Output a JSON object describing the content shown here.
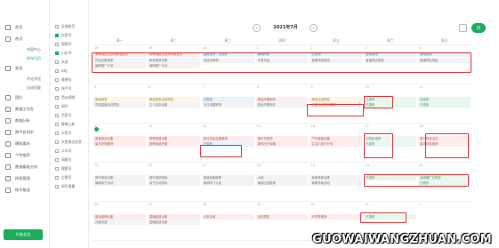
{
  "sidebar": {
    "items": [
      {
        "label": "首页",
        "icon": "home-icon"
      },
      {
        "label": "热点",
        "icon": "flame-icon"
      },
      {
        "label": "内容中心",
        "icon": "doc-icon",
        "sub": true
      },
      {
        "label": "发布日历",
        "icon": "calendar-icon",
        "sub": true,
        "active": true
      },
      {
        "label": "私信",
        "icon": "chat-icon"
      },
      {
        "label": "评论对话",
        "icon": "comment-icon",
        "sub": true
      },
      {
        "label": "自动回复",
        "icon": "reply-icon",
        "sub": true
      },
      {
        "label": "团队",
        "icon": "team-icon"
      },
      {
        "label": "数据工作台",
        "icon": "chart-icon"
      },
      {
        "label": "数据分析",
        "icon": "analytics-icon"
      },
      {
        "label": "跨平台同步",
        "icon": "sync-icon"
      },
      {
        "label": "爆款素材",
        "icon": "star-icon"
      },
      {
        "label": "个性推荐",
        "icon": "bulb-icon"
      },
      {
        "label": "数据看板分析",
        "icon": "board-icon"
      },
      {
        "label": "授权管理",
        "icon": "key-icon"
      },
      {
        "label": "帐号推送",
        "icon": "user-icon"
      }
    ],
    "footer_label": "升级会员"
  },
  "accounts": [
    {
      "label": "全部帐号",
      "checked": false
    },
    {
      "label": "抖音号",
      "checked": true
    },
    {
      "label": "视频号",
      "checked": false
    },
    {
      "label": "小红书",
      "checked": true
    },
    {
      "label": "头条",
      "checked": false
    },
    {
      "label": "B站",
      "checked": false
    },
    {
      "label": "微博号",
      "checked": false
    },
    {
      "label": "快手号",
      "checked": false
    },
    {
      "label": "西瓜视频",
      "checked": false
    },
    {
      "label": "知乎",
      "checked": false
    },
    {
      "label": "百家号",
      "checked": false
    },
    {
      "label": "微博上新",
      "checked": false
    },
    {
      "label": "大鱼号",
      "checked": false
    },
    {
      "label": "大鱼周边信息",
      "checked": false
    },
    {
      "label": "公众号",
      "checked": false
    },
    {
      "label": "网易号",
      "checked": false
    },
    {
      "label": "搜狐号",
      "checked": false
    },
    {
      "label": "企鹅号",
      "checked": false
    },
    {
      "label": "知乎直播",
      "checked": false
    }
  ],
  "toolbar": {
    "month_title": "2021年7月",
    "prev": "‹",
    "next": "›",
    "view_button": "月"
  },
  "weekdays": [
    "周一",
    "周二",
    "周三",
    "周四",
    "周五",
    "周六",
    "周日"
  ],
  "weeks": [
    {
      "days": [
        "28",
        "29",
        "30",
        "1",
        "2",
        "3",
        "4"
      ],
      "events": [
        [
          [
            "黑神话悟空游戏体验发布",
            "pink"
          ],
          [
            "黑神话悟空游戏体验发布",
            "pink"
          ],
          [
            "提前发布，已同步",
            "blue"
          ],
          [
            "顺利同步",
            "blue"
          ],
          [
            "已发布",
            "blue"
          ],
          [
            "自动发布",
            "blue"
          ],
          [
            "自动发布",
            "blue"
          ]
        ],
        [
          [
            "内容合集更新",
            "gray"
          ],
          [
            "新品推荐合集",
            "gray"
          ],
          [
            "内容待审核",
            "gray"
          ],
          [
            "本周总结",
            "gray"
          ],
          [
            "直播预告推送",
            "gray"
          ],
          [
            "直播预告推送",
            "gray"
          ],
          [
            "直播预告推送",
            "gray"
          ]
        ],
        [
          [
            "暑期推广计划",
            "gray"
          ],
          [
            "暑期推广计划",
            "gray"
          ],
          [
            "",
            "empty"
          ],
          [
            "",
            "empty"
          ],
          [
            "",
            "empty"
          ],
          [
            "",
            "empty"
          ],
          [
            "",
            "empty"
          ]
        ]
      ]
    },
    {
      "days": [
        "5",
        "6",
        "7",
        "8",
        "9",
        "10",
        "11"
      ],
      "events": [
        [
          [
            "",
            "empty"
          ],
          [
            "",
            "empty"
          ],
          [
            "",
            "empty"
          ],
          [
            "",
            "empty"
          ],
          [
            "",
            "empty"
          ],
          [
            "",
            "empty"
          ],
          [
            "",
            "empty"
          ]
        ],
        [
          [
            "新品首发",
            "yellow"
          ],
          [
            "新品首发活动预告",
            "yellow"
          ],
          [
            "已发布",
            "blue"
          ],
          [
            "新品开箱测评",
            "pink"
          ],
          [
            "周末活动预告",
            "yellow"
          ],
          [
            "已发布",
            "green"
          ],
          [
            "已发布",
            "green"
          ]
        ],
        [
          [
            "同城直播活动预告",
            "gray"
          ],
          [
            "达人探店合集",
            "gray"
          ],
          [
            "今日话题推荐",
            "gray"
          ],
          [
            "新品开箱测评",
            "gray"
          ],
          [
            "已发布已同步推荐",
            "pink"
          ],
          [
            "已发布",
            "green"
          ],
          [
            "已发布",
            "green"
          ]
        ]
      ]
    },
    {
      "days": [
        "12",
        "13",
        "14",
        "15",
        "16",
        "17",
        "18"
      ],
      "events": [
        [
          [
            "",
            "empty"
          ],
          [
            "",
            "empty"
          ],
          [
            "",
            "empty"
          ],
          [
            "",
            "empty"
          ],
          [
            "",
            "empty"
          ],
          [
            "",
            "empty"
          ],
          [
            "",
            "empty"
          ]
        ],
        [
          [
            "美食探店合集",
            "pink"
          ],
          [
            "夏季穿搭合集",
            "pink"
          ],
          [
            "夏日饮品合集推荐",
            "pink"
          ],
          [
            "音乐节现场",
            "pink"
          ],
          [
            "户外露营合集",
            "pink"
          ],
          [
            "已同步发布",
            "green"
          ],
          [
            "夏日特惠活动",
            "pink"
          ]
        ],
        [
          [
            "每日好物推荐",
            "pink"
          ],
          [
            "夏季新品开箱",
            "pink"
          ],
          [
            "已发布",
            "blue"
          ],
          [
            "周末出行攻略",
            "pink"
          ],
          [
            "生活小技巧分享",
            "pink"
          ],
          [
            "已发布",
            "green"
          ],
          [
            "周末特惠推荐",
            "pink"
          ]
        ]
      ]
    },
    {
      "days": [
        "19",
        "20",
        "21",
        "22",
        "23",
        "24",
        "25"
      ],
      "events": [
        [
          [
            "",
            "empty"
          ],
          [
            "",
            "empty"
          ],
          [
            "",
            "empty"
          ],
          [
            "",
            "empty"
          ],
          [
            "",
            "empty"
          ],
          [
            "",
            "empty"
          ],
          [
            "",
            "empty"
          ]
        ],
        [
          [
            "城市夜景合集",
            "gray"
          ],
          [
            "城市漫游指南",
            "gray"
          ],
          [
            "露营装备推荐",
            "gray"
          ],
          [
            "大促",
            "gray"
          ],
          [
            "美食推荐合集",
            "gray"
          ],
          [
            "已发布",
            "green"
          ],
          [
            "活动推广已同步",
            "green"
          ]
        ],
        [
          [
            "暑期亲子活动",
            "gray"
          ],
          [
            "亲子互动游戏",
            "gray"
          ],
          [
            "暑期学习计划",
            "gray"
          ],
          [
            "暑期出游推荐",
            "gray"
          ],
          [
            "暑期特卖活动",
            "gray"
          ],
          [
            "",
            "empty"
          ],
          [
            "已同步",
            "green"
          ]
        ]
      ]
    },
    {
      "days": [
        "26",
        "27",
        "28",
        "29",
        "30",
        "31",
        "1"
      ],
      "events": [
        [
          [
            "",
            "empty"
          ],
          [
            "",
            "empty"
          ],
          [
            "",
            "empty"
          ],
          [
            "",
            "empty"
          ],
          [
            "",
            "empty"
          ],
          [
            "",
            "empty"
          ],
          [
            "",
            "empty"
          ]
        ],
        [
          [
            "新品推荐合集",
            "pink"
          ],
          [
            "直播回放合集",
            "pink"
          ],
          [
            "月末总结",
            "pink"
          ],
          [
            "活动预告",
            "pink"
          ],
          [
            "开学季推荐",
            "pink"
          ],
          [
            "已发布",
            "green"
          ],
          [
            "",
            "empty"
          ]
        ],
        [
          [
            "月度总结",
            "gray"
          ],
          [
            "直播回放合集",
            "gray"
          ],
          [
            "",
            "empty"
          ],
          [
            "",
            "empty"
          ],
          [
            "",
            "empty"
          ],
          [
            "",
            "empty"
          ],
          [
            "",
            "empty"
          ]
        ]
      ]
    }
  ],
  "watermark": "GUOWAIWANGZHUAN.COM",
  "colors": {
    "accent": "#1aad5a",
    "highlight": "#e0393b"
  }
}
